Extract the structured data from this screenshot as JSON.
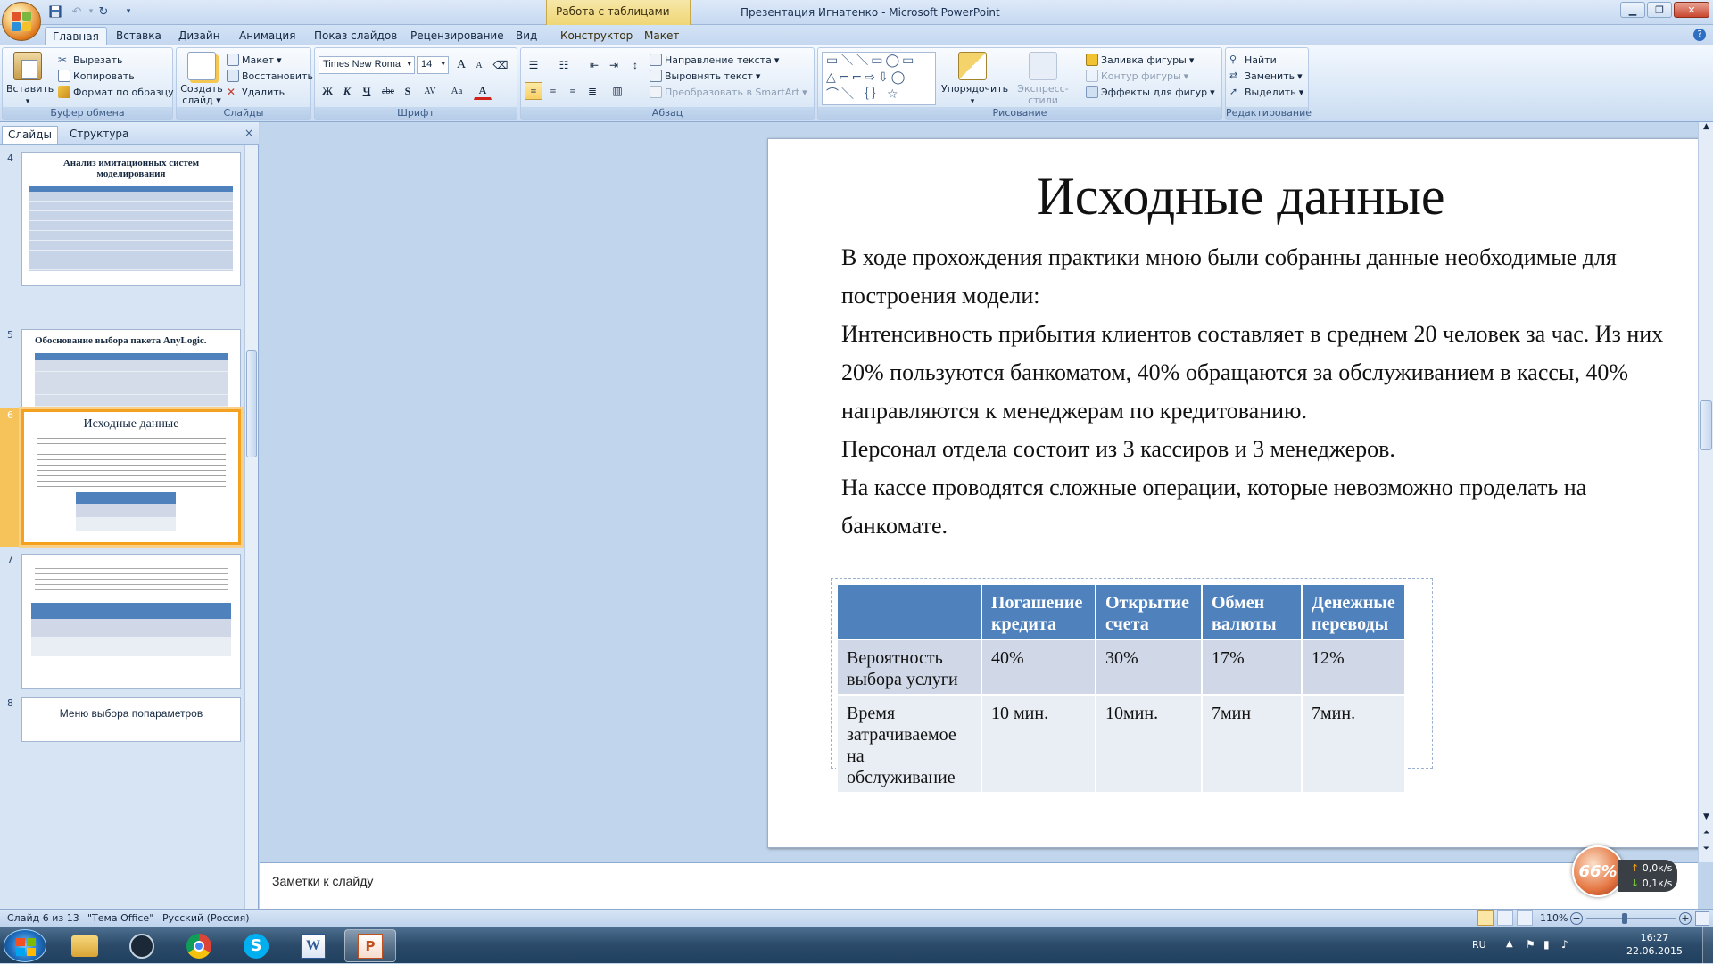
{
  "titlebar": {
    "context_tab": "Работа с таблицами",
    "window_title": "Презентация Игнатенко - Microsoft PowerPoint"
  },
  "tabs": [
    "Главная",
    "Вставка",
    "Дизайн",
    "Анимация",
    "Показ слайдов",
    "Рецензирование",
    "Вид",
    "Конструктор",
    "Макет"
  ],
  "ribbon": {
    "clipboard": {
      "paste": "Вставить",
      "cut": "Вырезать",
      "copy": "Копировать",
      "format_painter": "Формат по образцу",
      "label": "Буфер обмена"
    },
    "slides": {
      "new_slide": "Создать слайд",
      "layout": "Макет",
      "reset": "Восстановить",
      "delete": "Удалить",
      "label": "Слайды"
    },
    "font": {
      "family": "Times New Roma",
      "size": "14",
      "label": "Шрифт",
      "bold": "Ж",
      "italic": "К",
      "underline": "Ч",
      "strike": "abe",
      "shadow": "S",
      "spacing": "AV",
      "case": "Aa",
      "color": "A",
      "grow": "A",
      "shrink": "A"
    },
    "paragraph": {
      "text_direction": "Направление текста",
      "align_text": "Выровнять текст",
      "smartart": "Преобразовать в SmartArt",
      "label": "Абзац"
    },
    "drawing": {
      "arrange": "Упорядочить",
      "quick_styles": "Экспресс-стили",
      "fill": "Заливка фигуры",
      "outline": "Контур фигуры",
      "effects": "Эффекты для фигур",
      "label": "Рисование"
    },
    "editing": {
      "find": "Найти",
      "replace": "Заменить",
      "select": "Выделить",
      "label": "Редактирование"
    }
  },
  "left_panel": {
    "tab_slides": "Слайды",
    "tab_outline": "Структура",
    "close": "×",
    "thumbs": [
      {
        "num": "4",
        "title": "Анализ имитационных систем моделирования"
      },
      {
        "num": "5",
        "title": "Обоснование выбора пакета AnyLogic."
      },
      {
        "num": "6",
        "title": "Исходные данные"
      },
      {
        "num": "7",
        "title": ""
      },
      {
        "num": "8",
        "title": "Меню выбора попараметров"
      }
    ]
  },
  "slide": {
    "title": "Исходные данные",
    "paragraphs": [
      "В ходе прохождения практики мною были собранны данные необходимые для построения модели:",
      "Интенсивность прибытия клиентов составляет в среднем 20 человек за час. Из них 20% пользуются банкоматом, 40% обращаются за обслуживанием в кассы, 40% направляются к менеджерам по кредитованию.",
      "Персонал отдела состоит из 3 кассиров и 3 менеджеров.",
      "На кассе проводятся сложные операции, которые невозможно проделать на банкомате."
    ],
    "table": {
      "headers": [
        "",
        "Погашение кредита",
        "Открытие счета",
        "Обмен валюты",
        "Денежные переводы"
      ],
      "rows": [
        [
          "Вероятность выбора услуги",
          "40%",
          "30%",
          "17%",
          "12%"
        ],
        [
          "Время затрачиваемое на обслуживание",
          "10 мин.",
          "10мин.",
          "7мин",
          "7мин."
        ]
      ]
    }
  },
  "notes": {
    "placeholder": "Заметки к слайду"
  },
  "statusbar": {
    "slide_counter": "Слайд 6 из 13",
    "theme": "\"Тема Office\"",
    "language": "Русский (Россия)",
    "zoom": "110%"
  },
  "net_widget": {
    "percent": "66%",
    "up": "0,0к/s",
    "down": "0,1к/s"
  },
  "taskbar": {
    "lang": "RU",
    "time": "16:27",
    "date": "22.06.2015"
  },
  "colors": {
    "accent": "#4f81bd",
    "row1": "#d0d8e8",
    "row2": "#e9edf4",
    "selection": "#f4a11e"
  }
}
